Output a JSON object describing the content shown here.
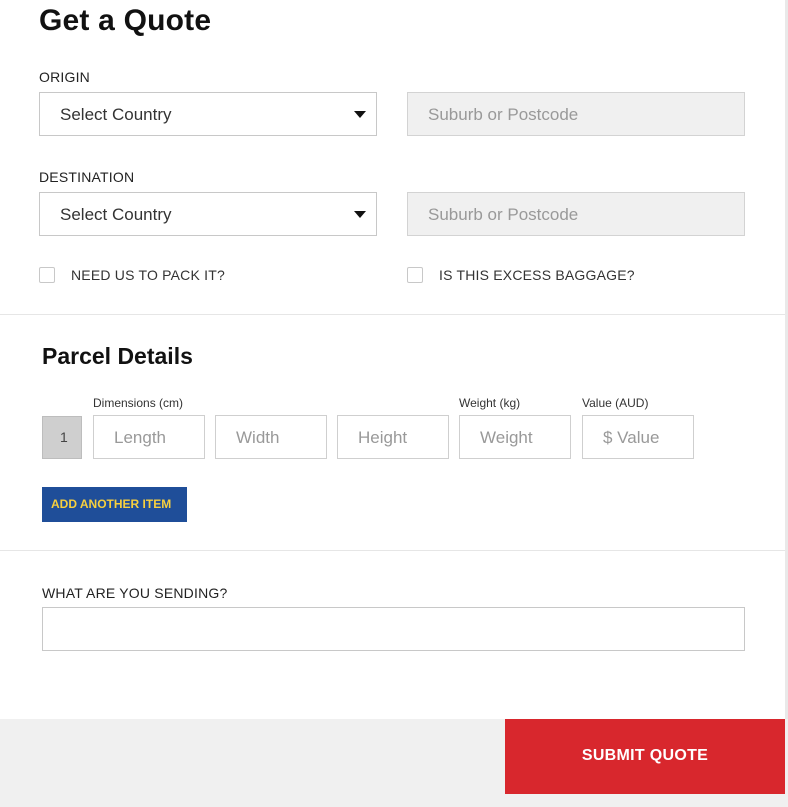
{
  "header": {
    "title": "Get a Quote"
  },
  "origin": {
    "label": "ORIGIN",
    "country_select": "Select Country",
    "postcode_placeholder": "Suburb or Postcode"
  },
  "destination": {
    "label": "DESTINATION",
    "country_select": "Select Country",
    "postcode_placeholder": "Suburb or Postcode"
  },
  "options": {
    "pack_label": "NEED US TO PACK IT?",
    "pack_checked": false,
    "baggage_label": "IS THIS EXCESS BAGGAGE?",
    "baggage_checked": false
  },
  "parcel": {
    "title": "Parcel Details",
    "dimensions_label": "Dimensions (cm)",
    "weight_label": "Weight (kg)",
    "value_label": "Value (AUD)",
    "item_index": "1",
    "length_placeholder": "Length",
    "width_placeholder": "Width",
    "height_placeholder": "Height",
    "weight_placeholder": "Weight",
    "value_placeholder": "$ Value",
    "add_item_label": "ADD ANOTHER ITEM"
  },
  "sending": {
    "label": "WHAT ARE YOU SENDING?",
    "value": ""
  },
  "footer": {
    "submit_label": "SUBMIT QUOTE"
  },
  "colors": {
    "add_button_bg": "#1f4e99",
    "add_button_text": "#f6cf3f",
    "submit_bg": "#d8272d",
    "postcode_bg": "#f0f0f0"
  }
}
